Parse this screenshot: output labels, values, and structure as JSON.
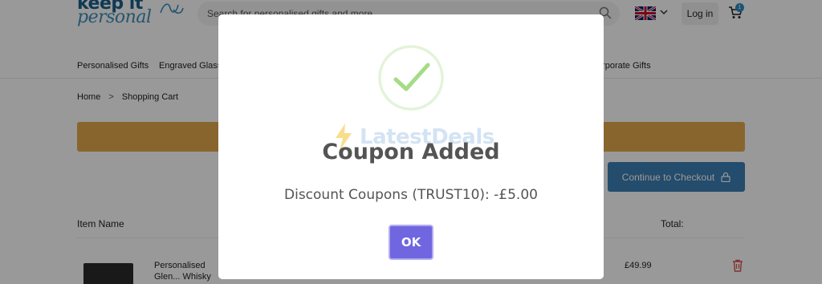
{
  "header": {
    "logo_top": "keep it",
    "logo_bottom": "personal",
    "search": {
      "placeholder": "Search for personalised gifts and more..."
    },
    "login_label": "Log in",
    "cart_count": "1"
  },
  "nav": {
    "items": [
      "Personalised Gifts",
      "Engraved Glasses",
      "Corporate Gifts"
    ]
  },
  "breadcrumb": {
    "home": "Home",
    "separator": ">",
    "current": "Shopping Cart"
  },
  "cart": {
    "checkout_label": "Continue to Checkout",
    "col_item": "Item Name",
    "col_total": "Total:",
    "rows": [
      {
        "name": "Personalised Glen... Whisky Glass",
        "price": "£49.99"
      }
    ]
  },
  "modal": {
    "title": "Coupon Added",
    "message": "Discount Coupons (TRUST10): -£5.00",
    "ok_label": "OK",
    "watermark": "LatestDeals"
  },
  "colors": {
    "accent": "#7066e0",
    "success": "#a5dc86",
    "banner": "#e5a84e",
    "checkout": "#3c7fb5",
    "brand": "#1a5f8c"
  }
}
